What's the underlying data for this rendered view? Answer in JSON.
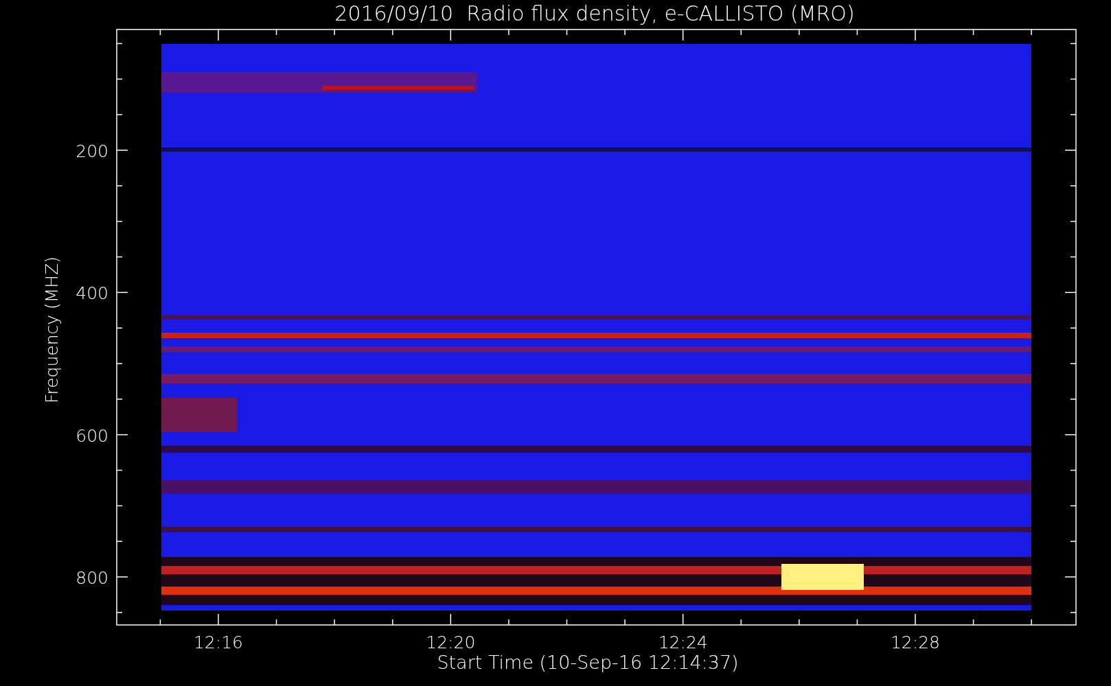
{
  "title": "2016/09/10  Radio flux density, e-CALLISTO (MRO)",
  "y_axis": {
    "title": "Frequency (MHZ)",
    "tick_labels": [
      "200",
      "400",
      "600",
      "800"
    ]
  },
  "x_axis": {
    "title": "Start Time (10-Sep-16 12:14:37)",
    "tick_labels": [
      "12:16",
      "12:20",
      "12:24",
      "12:28"
    ]
  }
}
